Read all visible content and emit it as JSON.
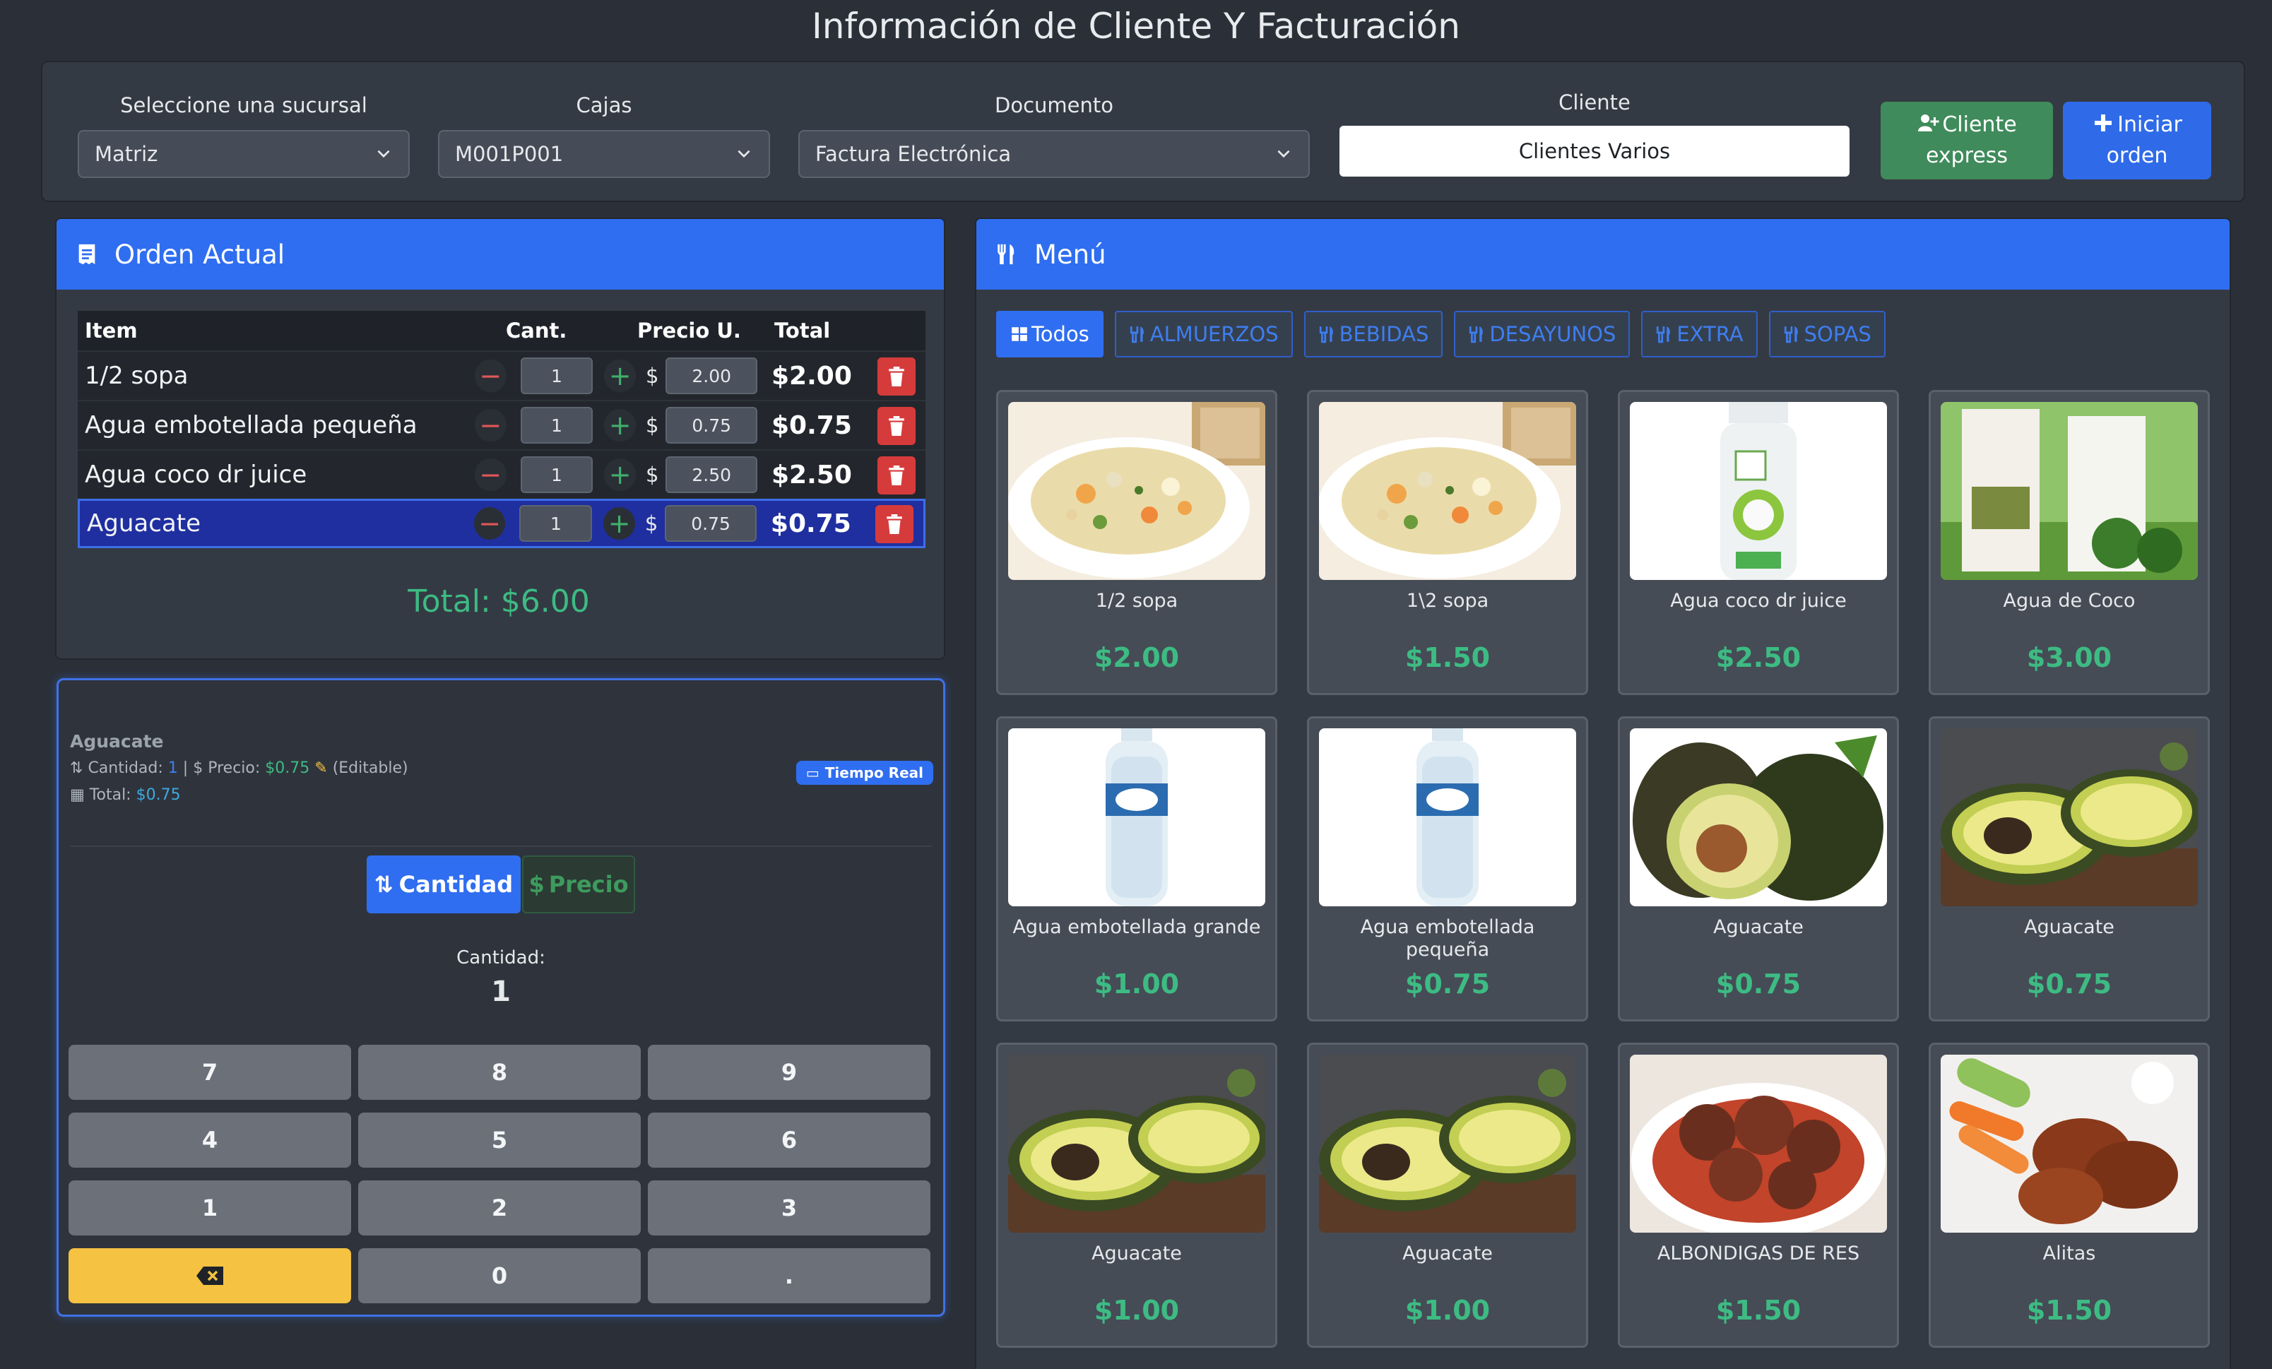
{
  "title": "Información de Cliente Y Facturación",
  "header": {
    "sucursal_label": "Seleccione una sucursal",
    "sucursal_value": "Matriz",
    "cajas_label": "Cajas",
    "cajas_value": "M001P001",
    "documento_label": "Documento",
    "documento_value": "Factura Electrónica",
    "cliente_label": "Cliente",
    "cliente_value": "Clientes Varios",
    "cliente_express_line1": "Cliente",
    "cliente_express_line2": "express",
    "iniciar_line1": "Iniciar",
    "iniciar_line2": "orden"
  },
  "order": {
    "title": "Orden Actual",
    "headers": {
      "item": "Item",
      "cant": "Cant.",
      "price": "Precio U.",
      "total": "Total"
    },
    "currency": "$",
    "rows": [
      {
        "item": "1/2 sopa",
        "qty": "1",
        "price": "2.00",
        "total": "$2.00"
      },
      {
        "item": "Agua embotellada pequeña",
        "qty": "1",
        "price": "0.75",
        "total": "$0.75"
      },
      {
        "item": "Agua coco dr juice",
        "qty": "1",
        "price": "2.50",
        "total": "$2.50"
      },
      {
        "item": "Aguacate",
        "qty": "1",
        "price": "0.75",
        "total": "$0.75"
      }
    ],
    "grand_total": "Total: $6.00"
  },
  "keypad": {
    "item_name": "Aguacate",
    "cantidad_label": "Cantidad:",
    "cantidad_value": "1",
    "sep1": "|",
    "precio_label": "Precio:",
    "precio_value": "$0.75",
    "editable": "(Editable)",
    "total_label": "Total:",
    "total_value": "$0.75",
    "badge": "Tiempo Real",
    "mode_cantidad": "Cantidad",
    "mode_precio": "Precio",
    "display_label": "Cantidad:",
    "display_value": "1",
    "keys": [
      "7",
      "8",
      "9",
      "4",
      "5",
      "6",
      "1",
      "2",
      "3",
      "0",
      "."
    ]
  },
  "menu": {
    "title": "Menú",
    "categories": [
      "Todos",
      "ALMUERZOS",
      "BEBIDAS",
      "DESAYUNOS",
      "EXTRA",
      "SOPAS"
    ],
    "products": [
      {
        "name": "1/2 sopa",
        "price": "$2.00",
        "icon": "soup-image"
      },
      {
        "name": "1\\2 sopa",
        "price": "$1.50",
        "icon": "soup-image"
      },
      {
        "name": "Agua coco dr juice",
        "price": "$2.50",
        "icon": "coconut-bottle-image"
      },
      {
        "name": "Agua de Coco",
        "price": "$3.00",
        "icon": "coconut-carton-image"
      },
      {
        "name": "Agua embotellada grande",
        "price": "$1.00",
        "icon": "water-bottle-image"
      },
      {
        "name": "Agua embotellada pequeña",
        "price": "$0.75",
        "icon": "water-bottle-image"
      },
      {
        "name": "Aguacate",
        "price": "$0.75",
        "icon": "avocado-image"
      },
      {
        "name": "Aguacate",
        "price": "$0.75",
        "icon": "avocado-board-image"
      },
      {
        "name": "Aguacate",
        "price": "$1.00",
        "icon": "avocado-board-image"
      },
      {
        "name": "Aguacate",
        "price": "$1.00",
        "icon": "avocado-board-image"
      },
      {
        "name": "ALBONDIGAS DE RES",
        "price": "$1.50",
        "icon": "meatballs-image"
      },
      {
        "name": "Alitas",
        "price": "$1.50",
        "icon": "wings-image"
      }
    ]
  },
  "colors": {
    "accent": "#2f6ef0",
    "success": "#3dbb83",
    "danger": "#d63b3b",
    "warning": "#f5c242",
    "background": "#2b3038"
  }
}
